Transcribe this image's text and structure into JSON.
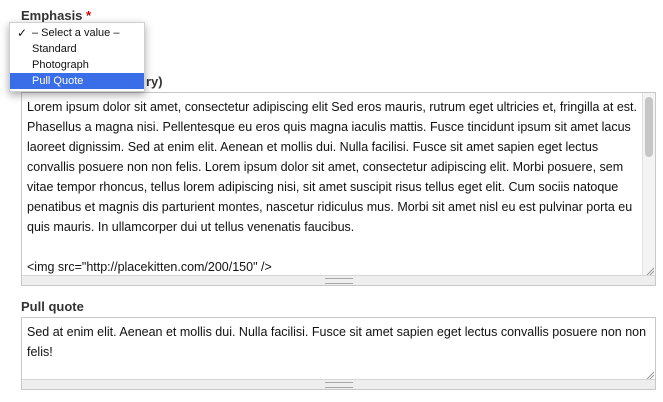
{
  "emphasis": {
    "label": "Emphasis",
    "required_mark": "*",
    "options": [
      "– Select a value –",
      "Standard",
      "Photograph",
      "Pull Quote"
    ],
    "checked_index": 0,
    "highlighted_index": 3
  },
  "body_field": {
    "label_visible_fragment": "ry)",
    "text": "Lorem ipsum dolor sit amet, consectetur adipiscing elit Sed eros mauris, rutrum eget ultricies et, fringilla at est. Phasellus a magna nisi. Pellentesque eu eros quis magna iaculis mattis. Fusce tincidunt ipsum sit amet lacus laoreet dignissim. Sed at enim elit. Aenean et mollis dui. Nulla facilisi. Fusce sit amet sapien eget lectus convallis posuere non non felis. Lorem ipsum dolor sit amet, consectetur adipiscing elit. Morbi posuere, sem vitae tempor rhoncus, tellus lorem adipiscing nisi, sit amet suscipit risus tellus eget elit. Cum sociis natoque penatibus et magnis dis parturient montes, nascetur ridiculus mus. Morbi sit amet nisl eu est pulvinar porta eu quis mauris. In ullamcorper dui ut tellus venenatis faucibus.\n\n<img src=\"http://placekitten.com/200/150\" />"
  },
  "pull_quote": {
    "label": "Pull quote",
    "text": "Sed at enim elit. Aenean et mollis dui. Nulla facilisi. Fusce sit amet sapien eget lectus convallis posuere non non felis!"
  },
  "colors": {
    "highlight": "#3a6ee8",
    "required": "#d40000"
  }
}
